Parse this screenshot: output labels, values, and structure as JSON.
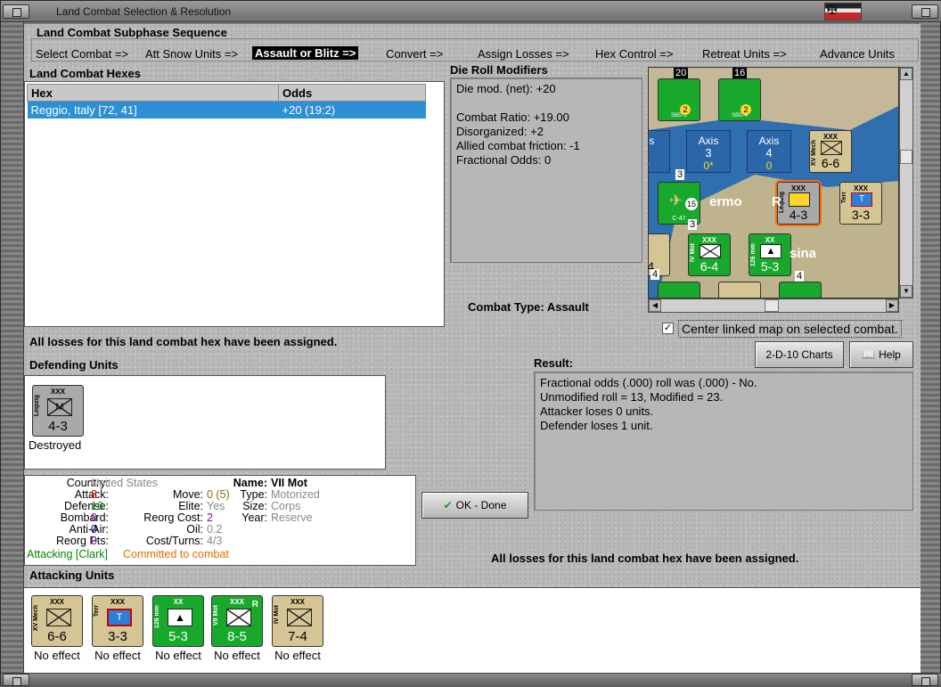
{
  "window": {
    "title": "Land Combat Selection & Resolution"
  },
  "subphase": {
    "heading": "Land Combat Subphase Sequence",
    "steps": [
      "Select Combat =>",
      "Att Snow Units =>",
      "Assault or Blitz =>",
      "Convert =>",
      "Assign Losses =>",
      "Hex Control =>",
      "Retreat Units =>",
      "Advance Units"
    ],
    "active_step": "Assault or Blitz =>"
  },
  "hexes": {
    "heading": "Land Combat Hexes",
    "columns": [
      "Hex",
      "Odds"
    ],
    "rows": [
      {
        "hex": "Reggio, Italy [72, 41]",
        "odds": "+20 (19:2)"
      }
    ]
  },
  "die_roll": {
    "heading": "Die Roll Modifiers",
    "lines": [
      "Die mod. (net): +20",
      "",
      "Combat Ratio: +19.00",
      "Disorganized: +2",
      "Allied combat friction: -1",
      "Fractional Odds: 0"
    ]
  },
  "combat_type": "Combat Type:  Assault",
  "map": {
    "counters_top": [
      {
        "label": "SBD-1",
        "badge": "2",
        "stack": "20"
      },
      {
        "label": "SBD-4",
        "badge": "2",
        "stack": "16"
      }
    ],
    "axis_boxes": [
      {
        "title": "xis",
        "num": "",
        "extra": "*"
      },
      {
        "title": "Axis",
        "num": "3",
        "extra": "0*"
      },
      {
        "title": "Axis",
        "num": "4",
        "extra": "0"
      }
    ],
    "place_labels": [
      "ermo",
      "R",
      "sina"
    ],
    "units": [
      {
        "name": "XV Mech",
        "size": "XXX",
        "strength": "6-6"
      },
      {
        "name": "Leipzig",
        "size": "XXX",
        "strength": "4-3"
      },
      {
        "name": "Terr",
        "size": "XXX",
        "strength": "3-3"
      },
      {
        "name": "C-47",
        "size": "",
        "strength": "15"
      },
      {
        "name": "IV Mot",
        "size": "XXX",
        "strength": "6-4"
      },
      {
        "name": "126 mm",
        "size": "XX",
        "strength": "5-3"
      },
      {
        "name": "",
        "size": "",
        "strength": "-4"
      }
    ],
    "stack_numbers": [
      "3",
      "3",
      "4",
      "4"
    ]
  },
  "center_map": {
    "label": "Center linked map on selected combat.",
    "checked": true
  },
  "buttons": {
    "charts": "2-D-10 Charts",
    "help": "Help",
    "ok": "OK - Done"
  },
  "messages": {
    "losses_assigned_left": "All losses for this land combat hex have been assigned.",
    "losses_assigned_right": "All losses for this land combat hex have been assigned."
  },
  "defending": {
    "heading": "Defending Units",
    "units": [
      {
        "side": "Leipzig",
        "size": "XXX",
        "symbol": "M",
        "strength": "4-3",
        "status": "Destroyed"
      }
    ]
  },
  "result": {
    "heading": "Result:",
    "lines": [
      "Fractional odds (.000) roll was (.000)  - No.",
      "Unmodified roll = 13, Modified = 23.",
      "Attacker loses 0 units.",
      "Defender loses 1 unit."
    ]
  },
  "stats": {
    "country_label": "Country:",
    "country": "United States",
    "attack_label": "Attack:",
    "attack": "8",
    "defense_label": "Defense:",
    "defense": "16",
    "bombard_label": "Bombard:",
    "bombard": "0",
    "antiair_label": "Anti-Air:",
    "antiair": "0",
    "reorg_pts_label": "Reorg Pts:",
    "reorg_pts": "0",
    "move_label": "Move:",
    "move": "0 (5)",
    "elite_label": "Elite:",
    "elite": "Yes",
    "reorg_cost_label": "Reorg Cost:",
    "reorg_cost": "2",
    "oil_label": "Oil:",
    "oil": "0.2",
    "cost_turns_label": "Cost/Turns:",
    "cost_turns": "4/3",
    "name_label": "Name:",
    "name": "VII Mot",
    "type_label": "Type:",
    "type": "Motorized",
    "size_label": "Size:",
    "size": "Corps",
    "year_label": "Year:",
    "year": "Reserve",
    "status_attacking": "Attacking [Clark]",
    "status_committed": "Committed to combat"
  },
  "attacking": {
    "heading": "Attacking Units",
    "units": [
      {
        "side": "XV Mech",
        "size": "XXX",
        "strength": "6-6",
        "status": "No effect",
        "color": "tan"
      },
      {
        "side": "Terr",
        "size": "XXX",
        "strength": "3-3",
        "status": "No effect",
        "color": "tan"
      },
      {
        "side": "126 mm",
        "size": "XX",
        "strength": "5-3",
        "status": "No effect",
        "color": "green"
      },
      {
        "side": "VII Mot",
        "size": "XXX",
        "strength": "8-5",
        "status": "No effect",
        "color": "green",
        "tag": "R"
      },
      {
        "side": "IV Mot",
        "size": "XXX",
        "strength": "7-4",
        "status": "No effect",
        "color": "tan"
      }
    ]
  },
  "colors": {
    "selection": "#2d8fd6",
    "allied_green": "#18a82c",
    "axis_tan": "#d6c594",
    "sea_blue": "#2f6fb0"
  }
}
